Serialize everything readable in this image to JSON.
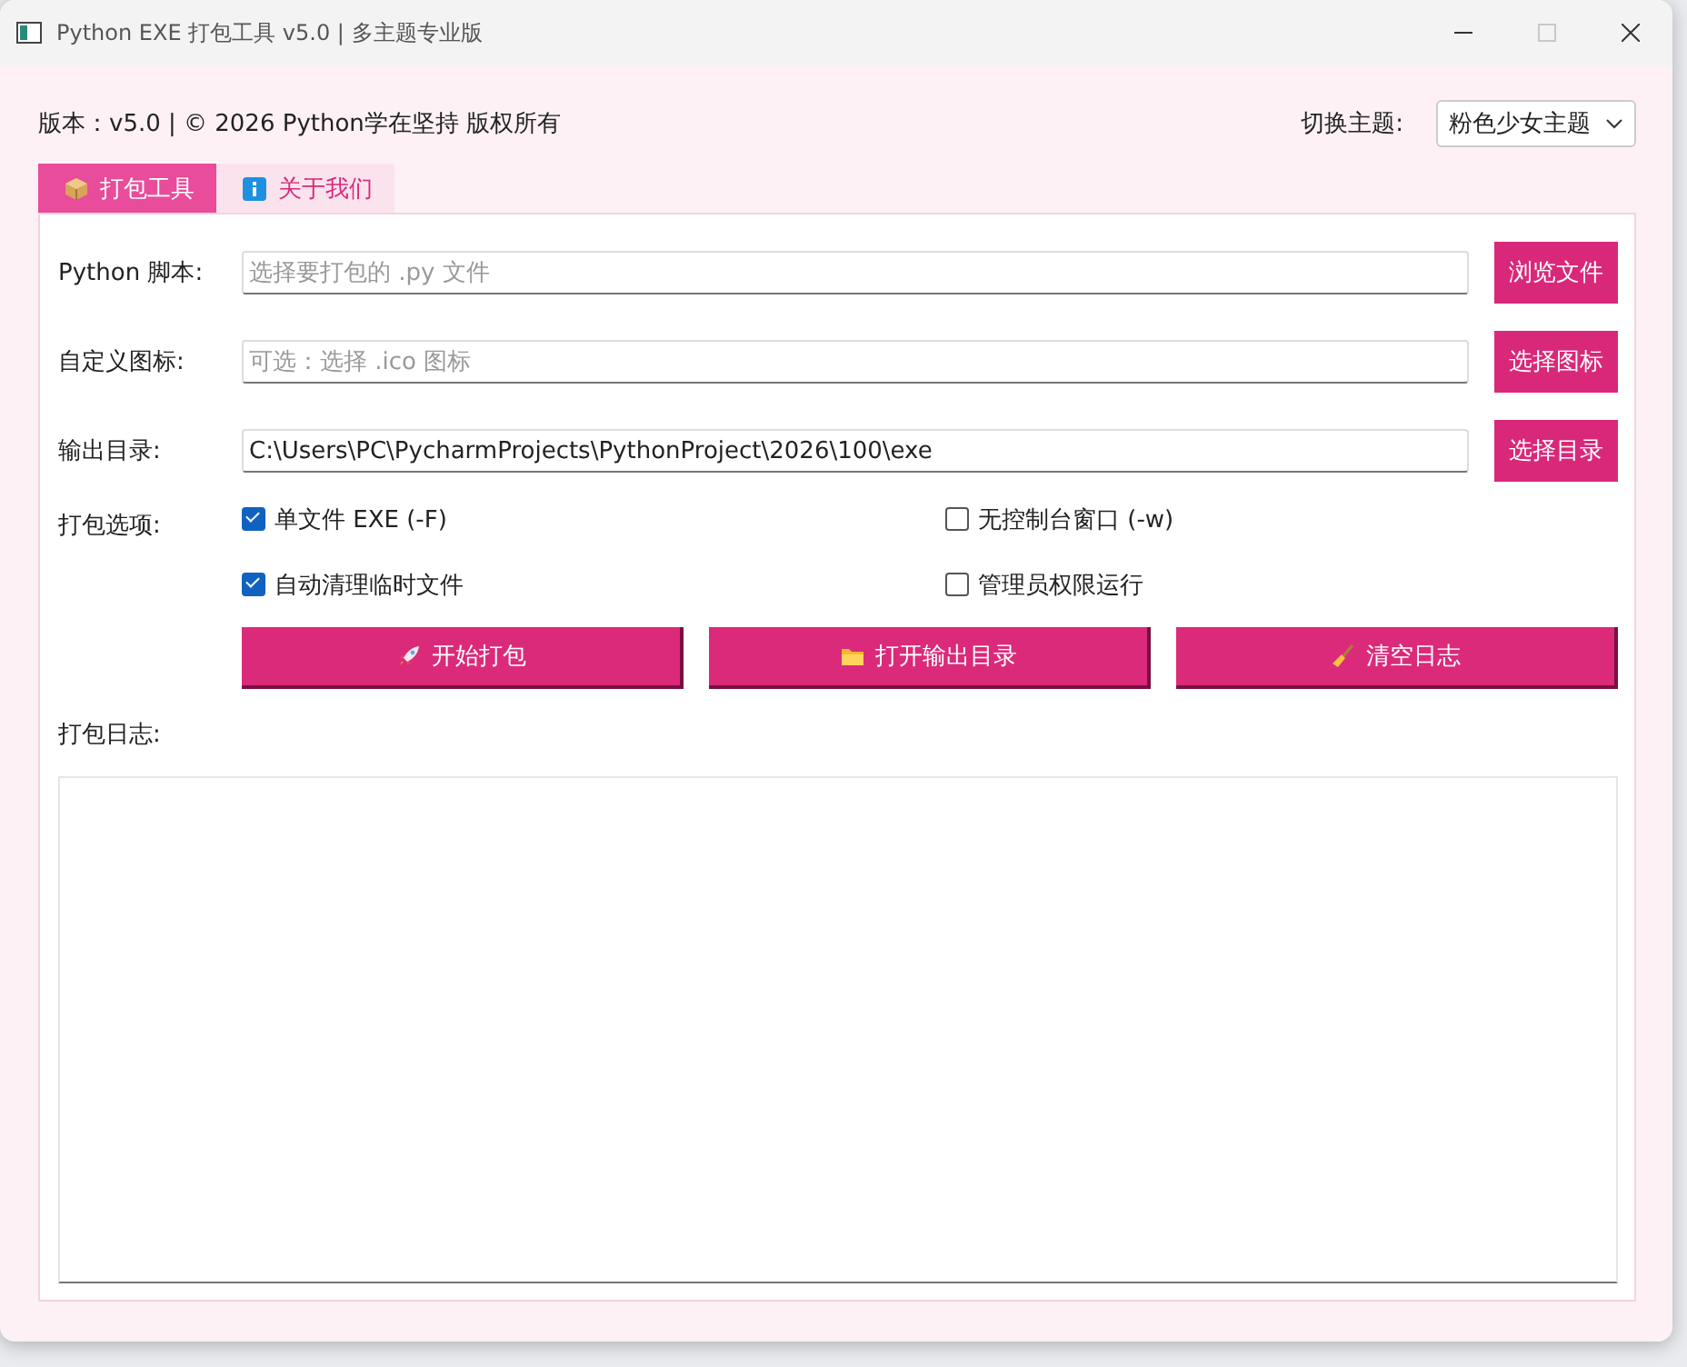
{
  "window": {
    "title": "Python EXE 打包工具 v5.0 | 多主题专业版",
    "maximize_disabled": true
  },
  "header": {
    "copyright": "版本：v5.0  |  © 2026 Python学在坚持 版权所有",
    "theme_label": "切换主题:",
    "theme_value": "粉色少女主题"
  },
  "tabs": [
    {
      "label": "打包工具",
      "selected": true
    },
    {
      "label": "关于我们",
      "selected": false
    }
  ],
  "fields": [
    {
      "label": "Python 脚本:",
      "placeholder": "选择要打包的 .py 文件",
      "button": "浏览文件"
    },
    {
      "label": "自定义图标:",
      "placeholder": "可选：选择 .ico 图标",
      "button": "选择图标"
    },
    {
      "label": "输出目录:",
      "value": "C:\\Users\\PC\\PycharmProjects\\PythonProject\\2026\\100\\exe",
      "button": "选择目录"
    }
  ],
  "options": {
    "label": "打包选项:",
    "items": [
      {
        "label": "单文件 EXE (-F)",
        "checked": true
      },
      {
        "label": "无控制台窗口 (-w)",
        "checked": false
      },
      {
        "label": "自动清理临时文件",
        "checked": true
      },
      {
        "label": "管理员权限运行",
        "checked": false
      }
    ]
  },
  "actions": [
    {
      "label": "开始打包"
    },
    {
      "label": "打开输出目录"
    },
    {
      "label": "清空日志"
    }
  ],
  "log": {
    "label": "打包日志:"
  }
}
